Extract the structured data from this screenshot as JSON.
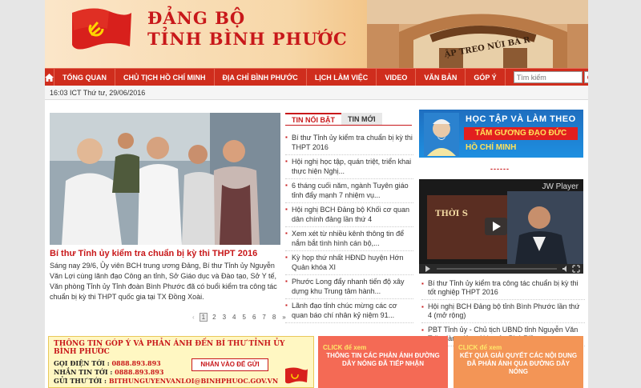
{
  "header": {
    "brand_line1": "ĐẢNG BỘ",
    "brand_line2": "TỈNH BÌNH PHƯỚC",
    "gate_sign": "ẬP TREO NÚI BÀ R"
  },
  "nav": {
    "items": [
      "TỔNG QUAN",
      "CHỦ TỊCH HỒ CHÍ MINH",
      "ĐỊA CHỈ BÌNH PHƯỚC",
      "LỊCH LÀM VIỆC",
      "VIDEO",
      "VĂN BẢN",
      "GÓP Ý"
    ],
    "search_placeholder": "Tìm kiếm",
    "search_button": "GO"
  },
  "datebar": {
    "text": "16:03 ICT Thứ tư, 29/06/2016"
  },
  "featured": {
    "title": "Bí thư Tỉnh ủy kiểm tra chuẩn bị kỳ thi THPT 2016",
    "text": "Sáng nay 29/6, Ủy viên BCH trung ương Đảng, Bí thư Tỉnh ủy Nguyễn Văn Lợi cùng lãnh đạo Công an tỉnh, Sở Giáo dục và Đào tạo, Sở Y tế, Văn phòng Tỉnh ủy Tỉnh đoàn Bình Phước đã có buổi kiểm tra công tác chuẩn bị kỳ thi THPT quốc gia tại TX Đồng Xoài.",
    "pages": [
      "1",
      "2",
      "3",
      "4",
      "5",
      "6",
      "7",
      "8",
      "»"
    ]
  },
  "tabs": {
    "active": "TIN NỔI BẬT",
    "other": "TIN MỚI"
  },
  "news": [
    "Bí thư Tỉnh ủy kiểm tra chuẩn bị kỳ thi THPT 2016",
    "Hội nghị học tập, quán triệt, triển khai thực hiện Nghị...",
    "6 tháng cuối năm, ngành Tuyên giáo tỉnh đẩy mạnh 7 nhiệm vụ...",
    "Hội nghị BCH Đảng bộ Khối cơ quan dân chính đảng lần thứ 4",
    "Xem xét từ nhiều kênh thông tin để nắm bắt tình hình cán bộ,...",
    "Kỳ họp thứ nhất HĐND huyện Hớn Quản khóa XI",
    "Phước Long đẩy nhanh tiến độ xây dựng khu Trung tâm hành...",
    "Lãnh đạo tỉnh chúc mừng các cơ quan báo chí nhân kỷ niệm 91..."
  ],
  "promo": {
    "line1": "HỌC TẬP VÀ LÀM THEO",
    "line2": "TẤM GƯƠNG ĐẠO ĐỨC",
    "line3": "HỒ CHÍ MINH"
  },
  "divider": "------",
  "player": {
    "label": "JW Player",
    "overlay": "THỜI S"
  },
  "right_news": [
    "Bí thư Tỉnh ủy kiểm tra công tác chuẩn bị kỳ thi tốt nghiệp THPT 2016",
    "Hội nghị BCH Đảng bộ tỉnh Bình Phước lần thứ 4 (mở rộng)",
    "PBT Tỉnh ủy - Chủ tịch UBND tỉnh Nguyễn Văn Trăm làm việc với huyện Phú Riềng"
  ],
  "feedback_box": {
    "heading": "THÔNG TIN GÓP Ý VÀ PHẢN ÁNH ĐẾN BÍ THƯ TỈNH ỦY BÌNH PHƯỚC",
    "rows": [
      {
        "label": "GỌI ĐIỆN TỚI :",
        "value": "0888.893.893"
      },
      {
        "label": "NHẮN TIN TỚI :",
        "value": "0888.893.893"
      },
      {
        "label": "GỬI THƯ TỚI :",
        "value": "BITHUNGUYENVANLOI@BINHPHUOC.GOV.VN"
      }
    ],
    "button": "NHẤN VÀO ĐỂ GỬI"
  },
  "hotline_box": {
    "click": "CLICK để xem",
    "text": "THÔNG TIN CÁC PHẢN ÁNH ĐƯỜNG DÂY NÓNG ĐÃ TIẾP NHẬN"
  },
  "result_box": {
    "click": "CLICK để xem",
    "text": "KẾT QUẢ GIẢI QUYẾT CÁC NỘI DUNG ĐÃ PHẢN ÁNH QUA ĐƯỜNG DÂY NÓNG"
  },
  "colors": {
    "brand_red": "#c8181a",
    "nav_red": "#cf2d1d",
    "promo_blue": "#1e8fe0"
  },
  "icons": {
    "home": "home-icon",
    "flag": "party-flag-icon"
  }
}
